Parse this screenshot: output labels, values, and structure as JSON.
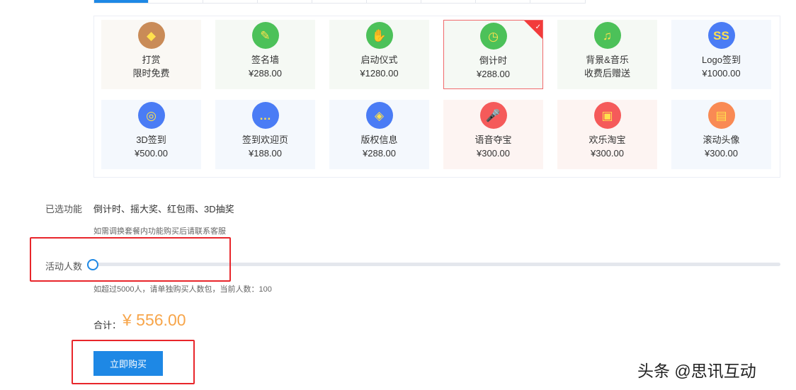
{
  "tabs": [
    "",
    "",
    "",
    "",
    "",
    "",
    "",
    "",
    ""
  ],
  "cards": [
    {
      "name": "打赏",
      "price": "限时免费",
      "icon": "gift-icon",
      "glyph": "◆",
      "color": "#c98b57",
      "bg": "#faf8f4"
    },
    {
      "name": "签名墙",
      "price": "¥288.00",
      "icon": "feather-icon",
      "glyph": "✎",
      "color": "#4cc159",
      "bg": "#f5f9f4"
    },
    {
      "name": "启动仪式",
      "price": "¥1280.00",
      "icon": "hand-icon",
      "glyph": "✋",
      "color": "#4cc159",
      "bg": "#f5f9f4"
    },
    {
      "name": "倒计时",
      "price": "¥288.00",
      "icon": "clock-icon",
      "glyph": "◷",
      "color": "#4cc159",
      "bg": "#f5f9f4",
      "selected": true
    },
    {
      "name": "背景&音乐",
      "price": "收费后赠送",
      "icon": "music-icon",
      "glyph": "♫",
      "color": "#4cc159",
      "bg": "#f5f9f4"
    },
    {
      "name": "Logo签到",
      "price": "¥1000.00",
      "icon": "logo-icon",
      "glyph": "SS",
      "color": "#4a7cf5",
      "bg": "#f4f8fd"
    },
    {
      "name": "3D签到",
      "price": "¥500.00",
      "icon": "planet-icon",
      "glyph": "◎",
      "color": "#4a7cf5",
      "bg": "#f4f8fd"
    },
    {
      "name": "签到欢迎页",
      "price": "¥188.00",
      "icon": "chat-icon",
      "glyph": "…",
      "color": "#4a7cf5",
      "bg": "#f4f8fd"
    },
    {
      "name": "版权信息",
      "price": "¥288.00",
      "icon": "shield-icon",
      "glyph": "◈",
      "color": "#4a7cf5",
      "bg": "#f4f8fd"
    },
    {
      "name": "语音夺宝",
      "price": "¥300.00",
      "icon": "microphone-icon",
      "glyph": "🎤",
      "color": "#f55a5a",
      "bg": "#fdf4f2"
    },
    {
      "name": "欢乐淘宝",
      "price": "¥300.00",
      "icon": "treasure-chest-icon",
      "glyph": "▣",
      "color": "#f55a5a",
      "bg": "#fdf4f2"
    },
    {
      "name": "滚动头像",
      "price": "¥300.00",
      "icon": "gift-box-icon",
      "glyph": "▤",
      "color": "#f98a54",
      "bg": "#f4f8fd"
    }
  ],
  "selected_label": "已选功能",
  "selected_value": "倒计时、摇大奖、红包雨、3D抽奖",
  "selected_hint": "如需调换套餐内功能购买后请联系客服",
  "people_label": "活动人数",
  "people_value": 100,
  "people_max": 5000,
  "people_hint": "如超过5000人，请单独购买人数包，当前人数：100",
  "total_label": "合计：",
  "total_value": "¥ 556.00",
  "buy_label": "立即购买",
  "watermark": "头条 @思讯互动"
}
